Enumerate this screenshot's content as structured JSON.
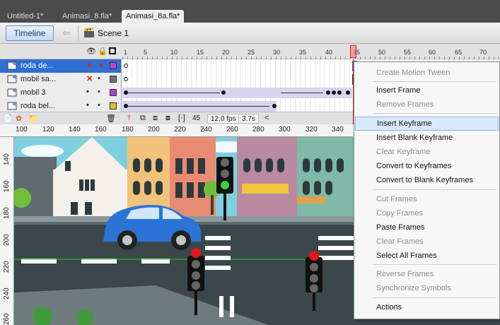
{
  "document_tabs": [
    "Untitled-1*",
    "Animasi_8.fla*",
    "Animasi_8a.fla*"
  ],
  "edit_bar": {
    "timeline_label": "Timeline",
    "scene_label": "Scene 1"
  },
  "timeline": {
    "ruler_numbers": [
      "1",
      "5",
      "10",
      "15",
      "20",
      "25",
      "30",
      "35",
      "40",
      "45",
      "50",
      "55",
      "60",
      "65",
      "70"
    ],
    "current_frame": 45,
    "layers": [
      {
        "name": "roda de...",
        "eye": "✕",
        "lock": "✕",
        "color": "#c040d0",
        "selected": true
      },
      {
        "name": "mobil sa...",
        "eye": "✕",
        "lock": "•",
        "color": "#707070",
        "selected": false
      },
      {
        "name": "mobil 3",
        "eye": "•",
        "lock": "•",
        "color": "#b040e0",
        "selected": false
      },
      {
        "name": "roda bel...",
        "eye": "•",
        "lock": "•",
        "color": "#e0c020",
        "selected": false
      }
    ],
    "footer": {
      "frame": "45",
      "fps": "12.0 fps",
      "time": "3.7s"
    }
  },
  "stage_ruler": {
    "horizontal": [
      "100",
      "120",
      "140",
      "160",
      "180",
      "200",
      "220",
      "240",
      "260",
      "280",
      "300",
      "320",
      "340"
    ],
    "vertical": [
      "140",
      "160",
      "180",
      "200",
      "220",
      "240",
      "260"
    ]
  },
  "context_menu": {
    "items": [
      {
        "label": "Create Motion Tween",
        "enabled": false
      },
      {
        "label": "Insert Frame",
        "enabled": true
      },
      {
        "label": "Remove Frames",
        "enabled": false
      },
      {
        "label": "Insert Keyframe",
        "enabled": true,
        "highlighted": true
      },
      {
        "label": "Insert Blank Keyframe",
        "enabled": true
      },
      {
        "label": "Clear Keyframe",
        "enabled": false
      },
      {
        "label": "Convert to Keyframes",
        "enabled": true
      },
      {
        "label": "Convert to Blank Keyframes",
        "enabled": true
      },
      {
        "label": "Cut Frames",
        "enabled": false
      },
      {
        "label": "Copy Frames",
        "enabled": false
      },
      {
        "label": "Paste Frames",
        "enabled": true
      },
      {
        "label": "Clear Frames",
        "enabled": false
      },
      {
        "label": "Select All Frames",
        "enabled": true
      },
      {
        "label": "Reverse Frames",
        "enabled": false
      },
      {
        "label": "Synchronize Symbols",
        "enabled": false
      },
      {
        "label": "Actions",
        "enabled": true
      }
    ]
  },
  "colors": {
    "selection": "#2f6fd4",
    "playhead": "#dd2222",
    "tween": "#d8d4f0",
    "menu_highlight": "#d9e8fb"
  }
}
